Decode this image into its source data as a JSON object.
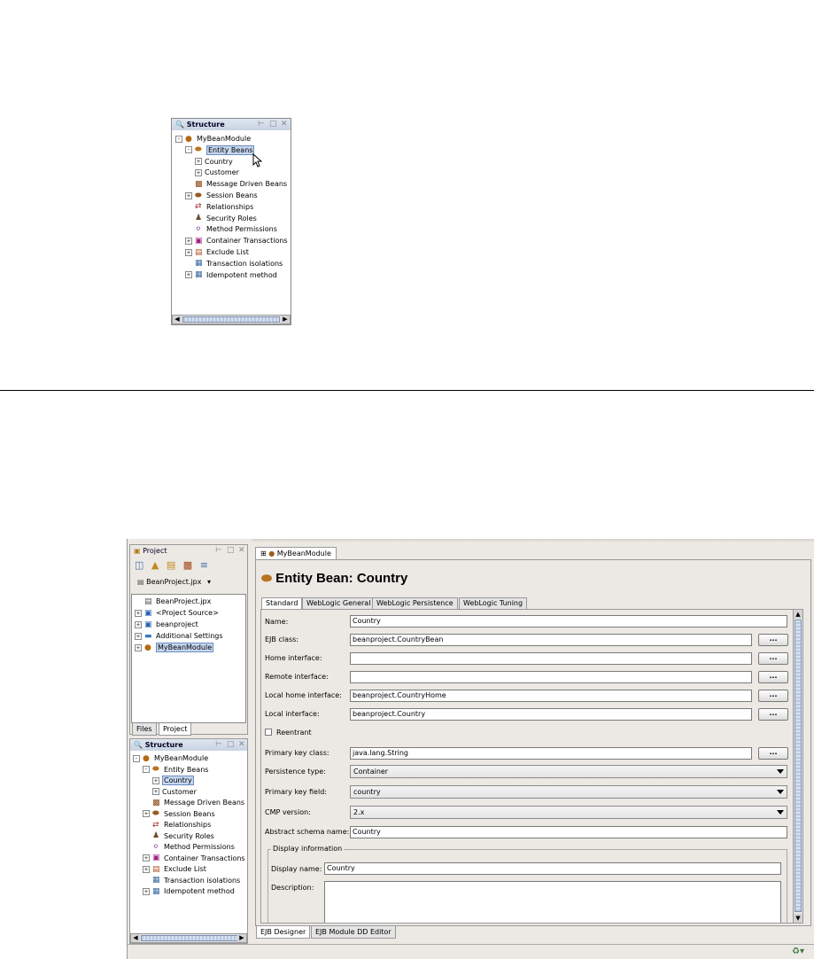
{
  "top_structure": {
    "title": "Structure",
    "tree": [
      {
        "label": "MyBeanModule",
        "level": 0,
        "expand": "-",
        "icon": "module-icon"
      },
      {
        "label": "Entity Beans",
        "level": 1,
        "expand": "-",
        "icon": "entity-beans-icon",
        "selected": true
      },
      {
        "label": "Country",
        "level": 2,
        "expand": "+",
        "icon": ""
      },
      {
        "label": "Customer",
        "level": 2,
        "expand": "+",
        "icon": ""
      },
      {
        "label": "Message Driven Beans",
        "level": 1,
        "expand": "",
        "icon": "message-bean-icon"
      },
      {
        "label": "Session Beans",
        "level": 1,
        "expand": "+",
        "icon": "session-bean-icon"
      },
      {
        "label": "Relationships",
        "level": 1,
        "expand": "",
        "icon": "relationships-icon"
      },
      {
        "label": "Security Roles",
        "level": 1,
        "expand": "",
        "icon": "security-roles-icon"
      },
      {
        "label": "Method Permissions",
        "level": 1,
        "expand": "",
        "icon": "method-permissions-icon"
      },
      {
        "label": "Container Transactions",
        "level": 1,
        "expand": "+",
        "icon": "container-transactions-icon"
      },
      {
        "label": "Exclude List",
        "level": 1,
        "expand": "+",
        "icon": "exclude-list-icon"
      },
      {
        "label": "Transaction isolations",
        "level": 1,
        "expand": "",
        "icon": "transaction-isolations-icon"
      },
      {
        "label": "Idempotent method",
        "level": 1,
        "expand": "+",
        "icon": "idempotent-method-icon"
      }
    ]
  },
  "project_panel": {
    "title": "Project",
    "project_file": "BeanProject.jpx",
    "tree": [
      {
        "label": "BeanProject.jpx",
        "level": 0,
        "expand": "",
        "icon": "project-file-icon"
      },
      {
        "label": "<Project Source>",
        "level": 0,
        "expand": "+",
        "icon": "package-icon"
      },
      {
        "label": "beanproject",
        "level": 0,
        "expand": "+",
        "icon": "package-icon"
      },
      {
        "label": "Additional Settings",
        "level": 0,
        "expand": "+",
        "icon": "folder-icon"
      },
      {
        "label": "MyBeanModule",
        "level": 0,
        "expand": "+",
        "icon": "module-icon",
        "selected": true
      }
    ],
    "tabs": [
      "Files",
      "Project"
    ]
  },
  "bottom_structure": {
    "title": "Structure",
    "tree": [
      {
        "label": "MyBeanModule",
        "level": 0,
        "expand": "-",
        "icon": "module-icon"
      },
      {
        "label": "Entity Beans",
        "level": 1,
        "expand": "-",
        "icon": "entity-beans-icon"
      },
      {
        "label": "Country",
        "level": 2,
        "expand": "+",
        "icon": "",
        "selected": true
      },
      {
        "label": "Customer",
        "level": 2,
        "expand": "+",
        "icon": ""
      },
      {
        "label": "Message Driven Beans",
        "level": 1,
        "expand": "",
        "icon": "message-bean-icon"
      },
      {
        "label": "Session Beans",
        "level": 1,
        "expand": "+",
        "icon": "session-bean-icon"
      },
      {
        "label": "Relationships",
        "level": 1,
        "expand": "",
        "icon": "relationships-icon"
      },
      {
        "label": "Security Roles",
        "level": 1,
        "expand": "",
        "icon": "security-roles-icon"
      },
      {
        "label": "Method Permissions",
        "level": 1,
        "expand": "",
        "icon": "method-permissions-icon"
      },
      {
        "label": "Container Transactions",
        "level": 1,
        "expand": "+",
        "icon": "container-transactions-icon"
      },
      {
        "label": "Exclude List",
        "level": 1,
        "expand": "+",
        "icon": "exclude-list-icon"
      },
      {
        "label": "Transaction isolations",
        "level": 1,
        "expand": "",
        "icon": "transaction-isolations-icon"
      },
      {
        "label": "Idempotent method",
        "level": 1,
        "expand": "+",
        "icon": "idempotent-method-icon"
      }
    ]
  },
  "editor": {
    "doc_tab": "MyBeanModule",
    "heading": "Entity Bean: Country",
    "tabs": [
      "Standard",
      "WebLogic General",
      "WebLogic Persistence",
      "WebLogic Tuning"
    ],
    "active_tab": 0,
    "fields": {
      "name_label": "Name:",
      "name_value": "Country",
      "ejb_class_label": "EJB class:",
      "ejb_class_value": "beanproject.CountryBean",
      "home_label": "Home interface:",
      "home_value": "",
      "remote_label": "Remote interface:",
      "remote_value": "",
      "local_home_label": "Local home interface:",
      "local_home_value": "beanproject.CountryHome",
      "local_label": "Local interface:",
      "local_value": "beanproject.Country",
      "reentrant_label": "Reentrant",
      "reentrant_checked": false,
      "pk_class_label": "Primary key class:",
      "pk_class_value": "java.lang.String",
      "persistence_label": "Persistence type:",
      "persistence_value": "Container",
      "pk_field_label": "Primary key field:",
      "pk_field_value": "country",
      "cmp_label": "CMP version:",
      "cmp_value": "2.x",
      "schema_label": "Abstract schema name:",
      "schema_value": "Country",
      "display_group": "Display information",
      "display_name_label": "Display name:",
      "display_name_value": "Country",
      "description_label": "Description:",
      "description_value": ""
    },
    "browse_label": "...",
    "bottom_tabs": [
      "EJB Designer",
      "EJB Module DD Editor"
    ]
  },
  "colors": {
    "selection": "#c6d7f0",
    "panel_header": "#d3dcea",
    "window_bg": "#ece9e4"
  }
}
